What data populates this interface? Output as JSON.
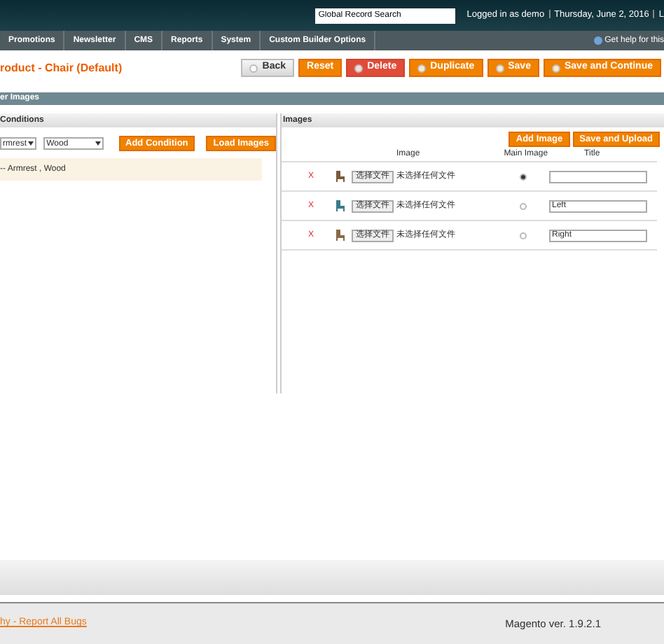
{
  "header": {
    "search": {
      "value": "Global Record Search"
    },
    "login": "Logged in as demo",
    "date": "Thursday, June 2, 2016",
    "cut": "L"
  },
  "nav": {
    "items": [
      "Promotions",
      "Newsletter",
      "CMS",
      "Reports",
      "System",
      "Custom Builder Options"
    ],
    "help": "Get help for this"
  },
  "page": {
    "title": "roduct - Chair (Default)",
    "buttons": [
      {
        "label": "Back",
        "kind": "back"
      },
      {
        "label": "Reset",
        "kind": "plain"
      },
      {
        "label": "Delete",
        "kind": "delete"
      },
      {
        "label": "Duplicate",
        "kind": "icon"
      },
      {
        "label": "Save",
        "kind": "icon"
      },
      {
        "label": "Save and Continue",
        "kind": "icon"
      }
    ]
  },
  "section": {
    "title": "er Images"
  },
  "conditions": {
    "title": "Conditions",
    "selects": [
      "rmrest",
      "Wood"
    ],
    "buttons": [
      "Add Condition",
      "Load Images"
    ],
    "rows": [
      {
        "label": "-- Armrest , Wood",
        "selected": true
      }
    ]
  },
  "images": {
    "title": "Images",
    "buttons": [
      "Add Image",
      "Save and Upload"
    ],
    "columns": [
      "Image",
      "Main Image",
      "Title"
    ],
    "rows": [
      {
        "remove": "X",
        "color": "#7a5a3a",
        "file_button": "选择文件",
        "file_status": "未选择任何文件",
        "selected": true,
        "title": ""
      },
      {
        "remove": "X",
        "color": "#3a7a8a",
        "file_button": "选择文件",
        "file_status": "未选择任何文件",
        "selected": false,
        "title": "Left"
      },
      {
        "remove": "X",
        "color": "#8a6a45",
        "file_button": "选择文件",
        "file_status": "未选择任何文件",
        "selected": false,
        "title": "Right"
      }
    ]
  },
  "footer": {
    "link": "hy - Report All Bugs",
    "version": "Magento ver. 1.9.2.1"
  }
}
